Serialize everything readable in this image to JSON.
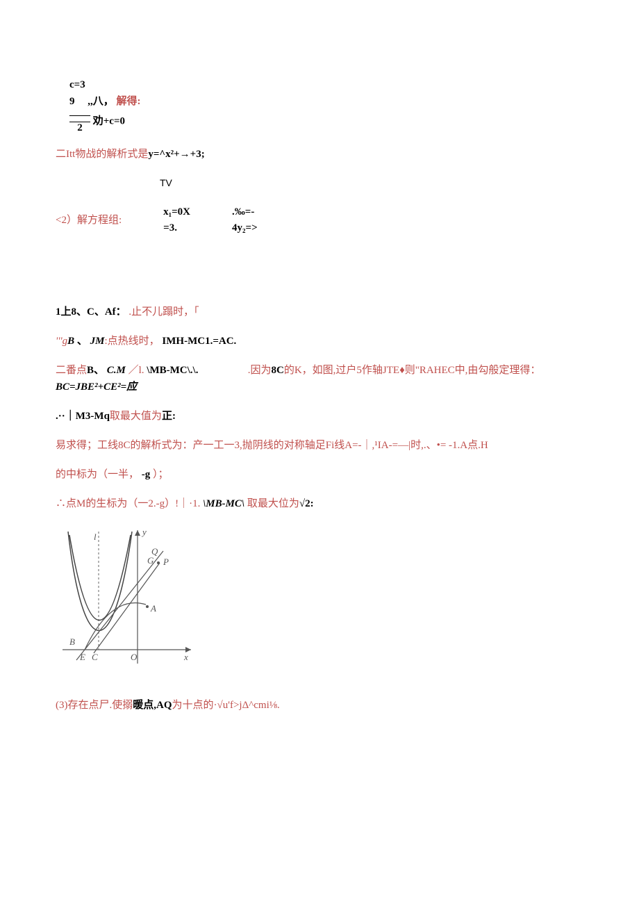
{
  "eq_group": {
    "line1": "c=3",
    "line2_left": "9",
    "line2_right": ",,八，",
    "line2_red": "解得:",
    "frac_num": "——",
    "frac_den": "2",
    "line3_tail": "劝+c=0"
  },
  "line_parabola": {
    "red_prefix": "二Itt物战的解析式是",
    "black": "y=^x²+→+3;"
  },
  "tv_label": "TV",
  "solve_label": "<2）解方程组:",
  "pair1": {
    "a": "x₁=0X",
    "b": "=3."
  },
  "pair2": {
    "a": ".‰=-",
    "b": "4y₂=>"
  },
  "line_1u8": {
    "black1": "1上8、C、Af：",
    "red": ".止不儿蹋时，「"
  },
  "line_gb": {
    "red1": "'''g",
    "black_ital": "B",
    "blackdot": "、",
    "ital2": "JM",
    "red2": ":点热线时，",
    "black_tail": "IMH-MC1.=AC."
  },
  "line_bcm": {
    "red1": "二番点",
    "b1": "B、",
    "ital": "C.M",
    "red2": "／l.",
    "b2": "\\MB-MC\\.\\.",
    "red3": ".因为",
    "b3": "8C",
    "red4": "的K，如图,",
    "red5": "过户5作轴JTE♦则\"RAHEC中,由勾般定理得：",
    "tail": "BC=JBE²+CE²=应"
  },
  "line_m3": {
    "b1": ".··｜M3-Mq",
    "red": "取最大值为",
    "b2": "正:"
  },
  "line_easy": {
    "red1": "易求得；工线8C的解析式为：产一工一3,抛阴线的对称轴足Fi线A=-｜,¹IA-=—|时,.、•= -1.A点.H"
  },
  "line_mid": {
    "red": "的中标为（一半，",
    "b": "-g",
    "red2": "）；"
  },
  "line_pointM": {
    "red1": "∴点M的生标为（一2.-g）!｜·1.",
    "b1": "\\MB-MC\\",
    "red2": "取最大位为",
    "b2": "√2:"
  },
  "fig": {
    "l": "l",
    "y": "y",
    "Q": "Q",
    "G": "G",
    "P": "P",
    "A": "A",
    "B": "B",
    "E": "E",
    "C": "C",
    "O": "O",
    "x": "x"
  },
  "line_exist": {
    "red1": "(3)存在点尸.使搦",
    "b1": "暖点,AQ",
    "red2": "为十点的·√u'f>jΔ^cmi⅛."
  }
}
